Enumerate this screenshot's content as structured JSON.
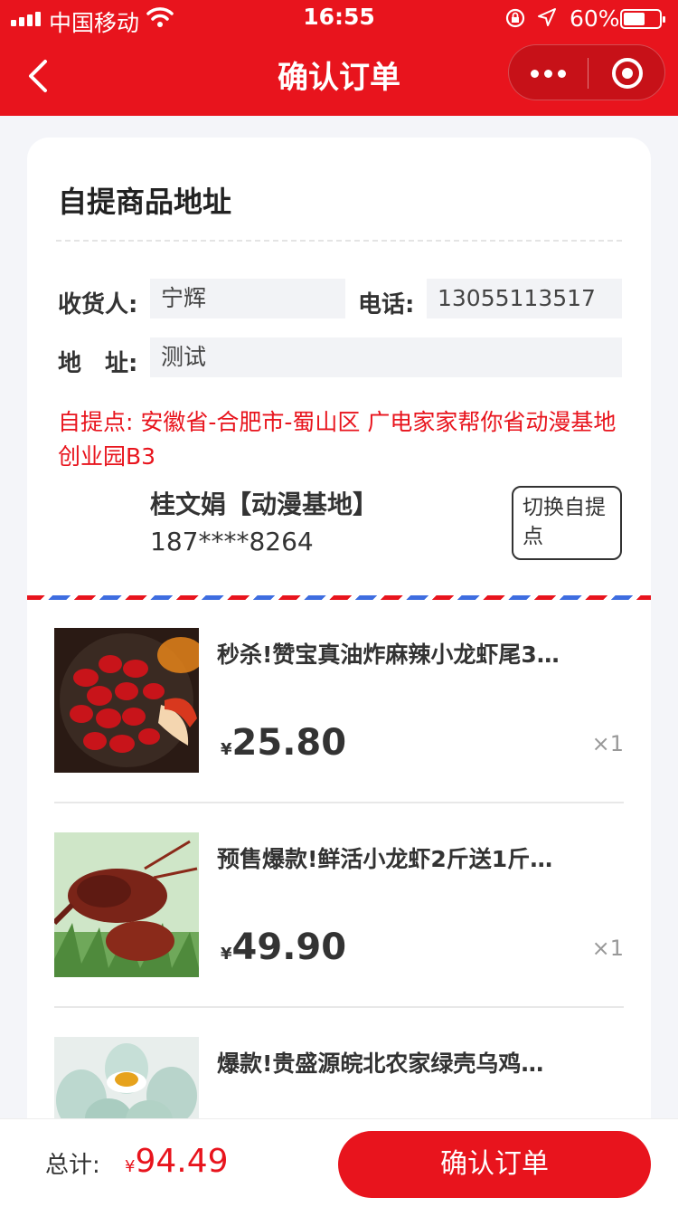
{
  "status_bar": {
    "carrier": "中国移动",
    "time": "16:55",
    "battery": "60%",
    "battery_level": 0.6
  },
  "nav": {
    "title": "确认订单",
    "back_icon": "chevron-left-icon",
    "more_icon": "more-dots-icon",
    "close_icon": "target-circle-icon"
  },
  "address": {
    "section_title": "自提商品地址",
    "receiver_label": "收货人:",
    "receiver_value": "宁辉",
    "phone_label": "电话:",
    "phone_value": "13055113517",
    "address_label": "地　址:",
    "address_value": "测试",
    "pickup_text": "自提点: 安徽省-合肥市-蜀山区 广电家家帮你省动漫基地创业园B3",
    "pickup_person": "桂文娟【动漫基地】",
    "pickup_phone": "187****8264",
    "switch_label": "切换自提点"
  },
  "items": [
    {
      "name": "秒杀!赞宝真油炸麻辣小龙虾尾3…",
      "currency": "¥",
      "price": "25.80",
      "qty": "×1"
    },
    {
      "name": "预售爆款!鲜活小龙虾2斤送1斤…",
      "currency": "¥",
      "price": "49.90",
      "qty": "×1"
    },
    {
      "name": "爆款!贵盛源皖北农家绿壳乌鸡…",
      "currency": "¥",
      "price": "",
      "qty": ""
    }
  ],
  "footer": {
    "total_label": "总计:",
    "currency": "¥",
    "total": "94.49",
    "confirm_label": "确认订单"
  },
  "colors": {
    "primary": "#e8141d",
    "airmail_blue": "#3e6de0",
    "page_bg": "#f4f5f9"
  }
}
